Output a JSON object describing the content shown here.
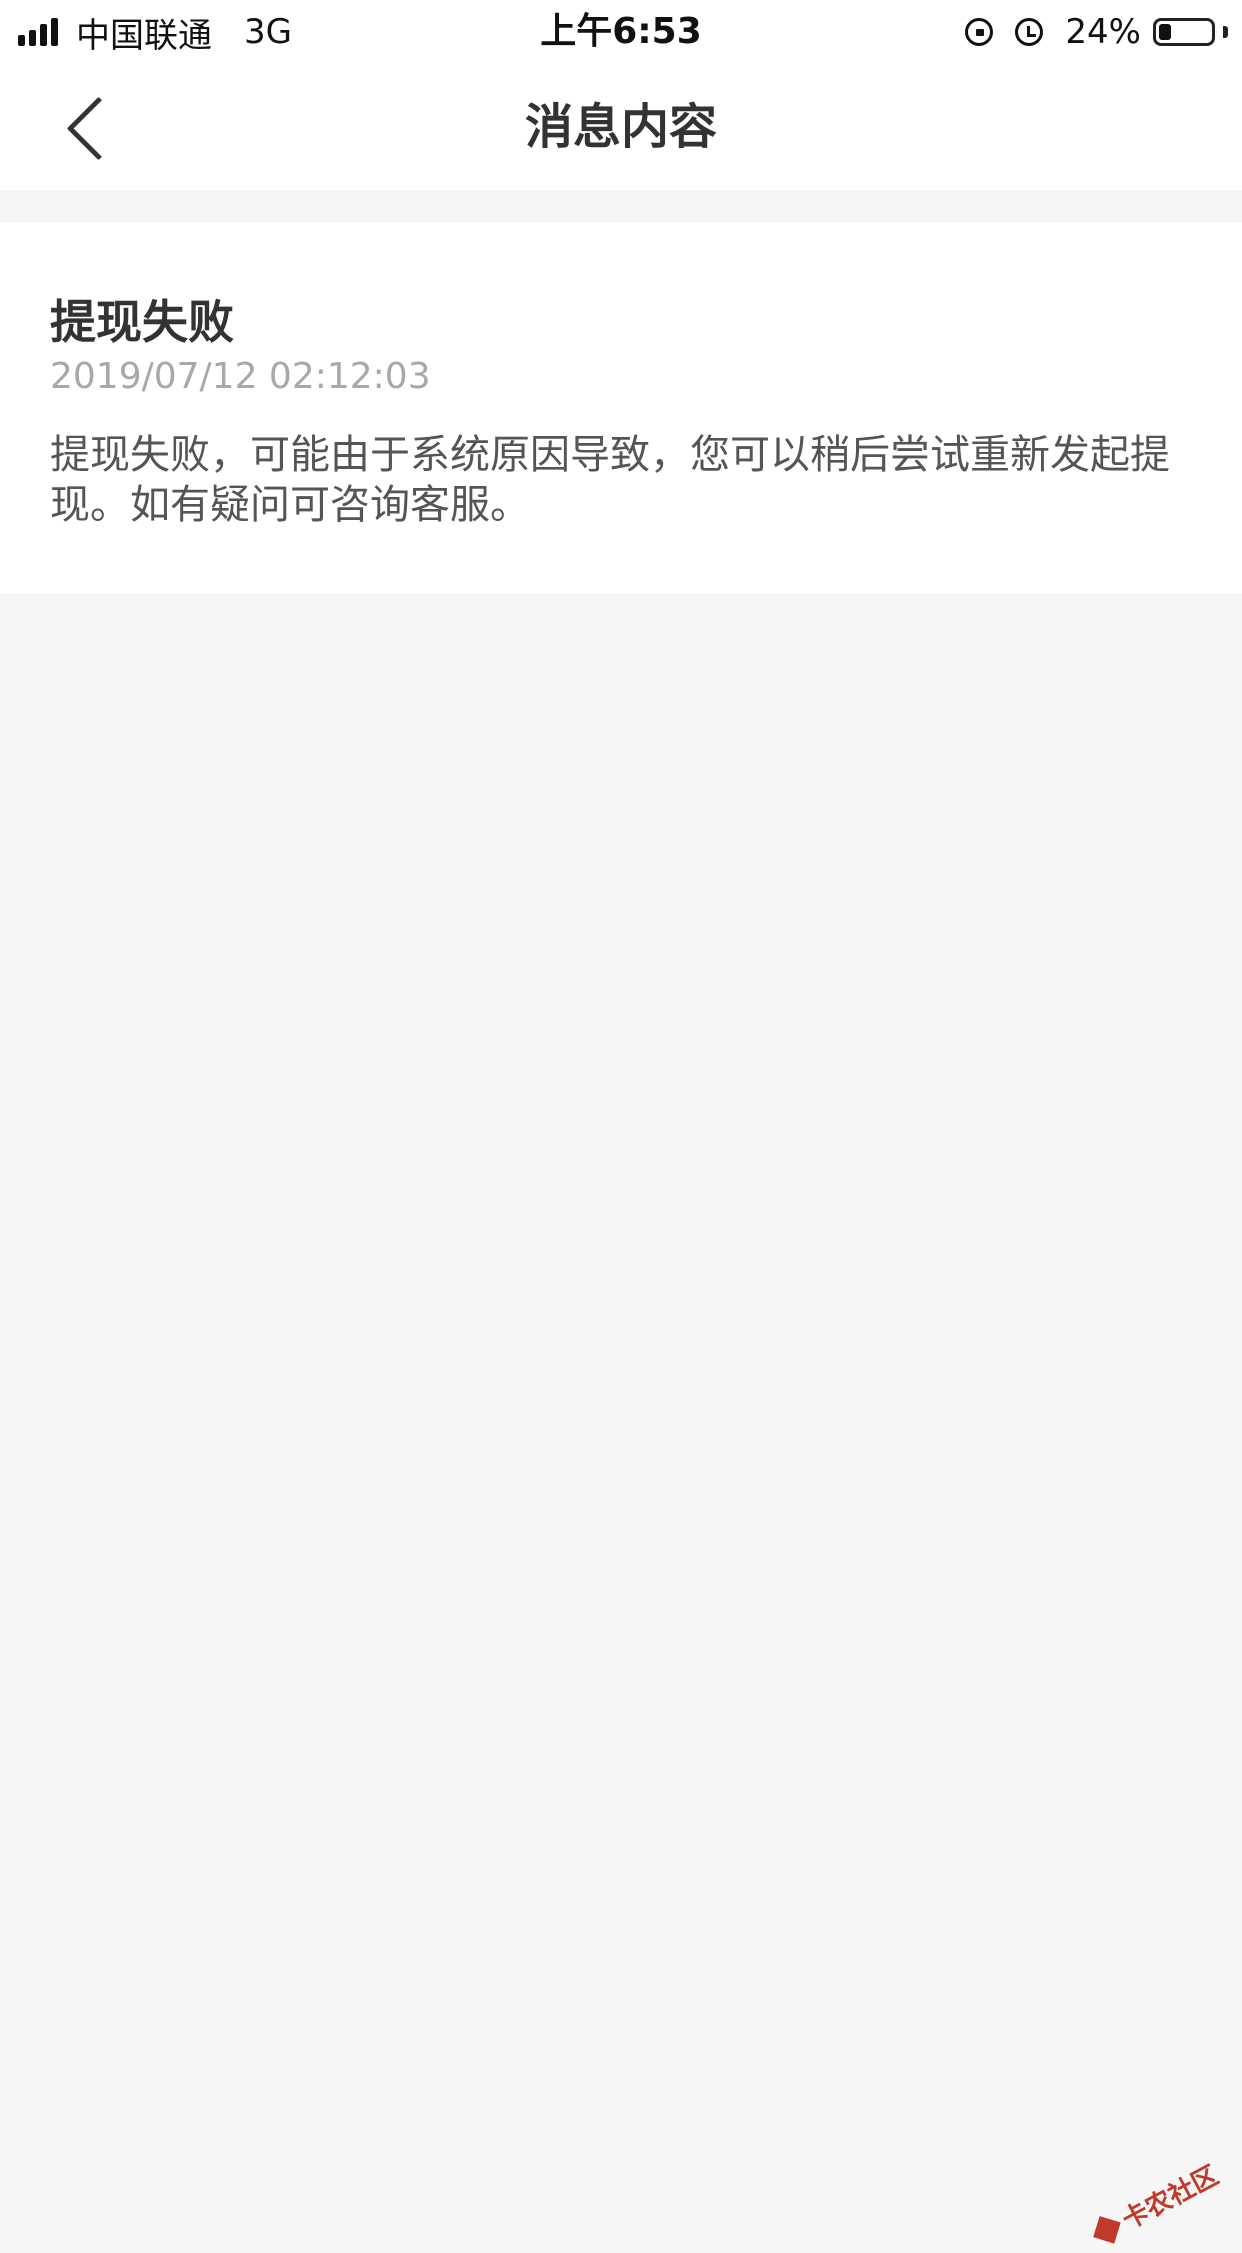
{
  "status_bar": {
    "carrier": "中国联通",
    "network": "3G",
    "time": "上午6:53",
    "battery_percent_label": "24%",
    "battery_level": 0.24
  },
  "nav": {
    "title": "消息内容"
  },
  "message": {
    "title": "提现失败",
    "timestamp": "2019/07/12 02:12:03",
    "body": "提现失败，可能由于系统原因导致，您可以稍后尝试重新发起提现。如有疑问可咨询客服。"
  },
  "watermark": {
    "text": "卡农社区"
  },
  "colors": {
    "background": "#f6f6f6",
    "card": "#ffffff",
    "text_primary": "#333333",
    "text_secondary": "#a8a8a8",
    "watermark": "#c0392b"
  },
  "icons": {
    "back": "chevron-left-icon",
    "orientation_lock": "orientation-lock-icon",
    "alarm": "alarm-icon",
    "battery": "battery-icon",
    "signal": "signal-icon"
  }
}
